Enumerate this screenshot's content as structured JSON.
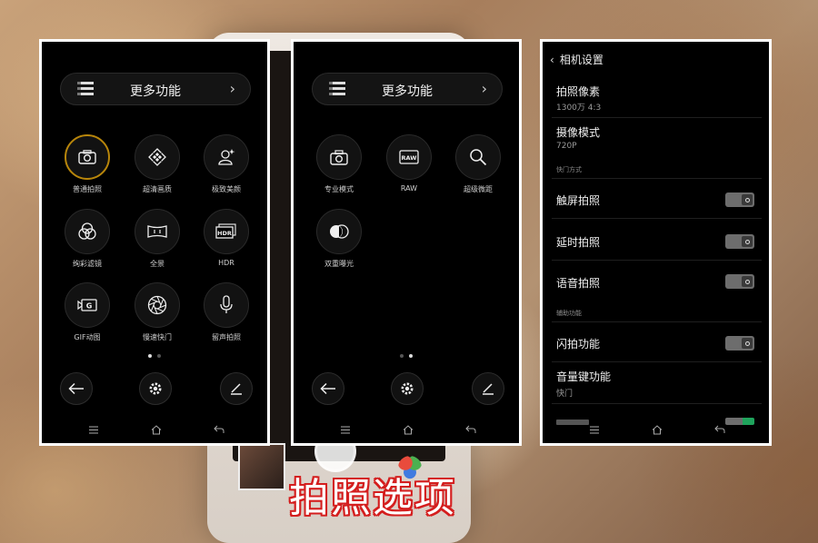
{
  "left_panel": {
    "more_label": "更多功能",
    "modes": [
      "普通拍照",
      "超清画质",
      "极致美颜",
      "绚彩滤镜",
      "全景",
      "HDR",
      "GIF动图",
      "慢速快门",
      "留声拍照"
    ],
    "active_mode": "普通拍照",
    "page_indicator": {
      "current": 1,
      "total": 2
    }
  },
  "mid_panel": {
    "more_label": "更多功能",
    "modes": [
      "专业模式",
      "RAW",
      "超级微距",
      "双重曝光"
    ],
    "raw_icon_text": "RAW",
    "page_indicator": {
      "current": 2,
      "total": 2
    }
  },
  "settings_panel": {
    "title": "相机设置",
    "rows": [
      {
        "title": "拍照像素",
        "sub": "1300万 4:3"
      },
      {
        "title": "摄像模式",
        "sub": "720P"
      }
    ],
    "section_shutter": "快门方式",
    "shutter_toggles": [
      {
        "label": "触屏拍照",
        "on": false
      },
      {
        "label": "延时拍照",
        "on": false
      },
      {
        "label": "语音拍照",
        "on": false
      }
    ],
    "section_assist": "辅助功能",
    "assist_toggles": [
      {
        "label": "闪拍功能",
        "on": false
      }
    ],
    "volume_row": {
      "title": "音量键功能",
      "sub": "快门"
    }
  },
  "hdr_icon_text": "HDR",
  "gif_icon_text": "G",
  "caption": "拍照选项",
  "accent_color": "#b8860b"
}
